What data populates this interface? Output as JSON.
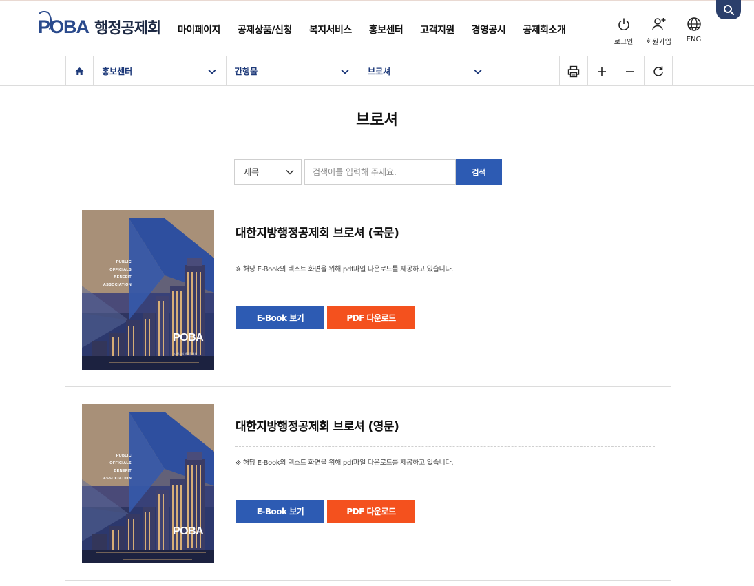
{
  "header": {
    "logo_mark": "POBA",
    "logo_name": "행정공제회",
    "nav": [
      "마이페이지",
      "공제상품/신청",
      "복지서비스",
      "홍보센터",
      "고객지원",
      "경영공시",
      "공제회소개"
    ],
    "util": {
      "login": "로그인",
      "join": "회원가입",
      "lang": "ENG"
    }
  },
  "location": {
    "depth1": "홍보센터",
    "depth2": "간행물",
    "depth3": "브로셔"
  },
  "page": {
    "title": "브로셔"
  },
  "search": {
    "field": "제목",
    "placeholder": "검색어를 입력해 주세요.",
    "button": "검색"
  },
  "cover": {
    "lines": [
      "PUBLIC",
      "OFFICIALS",
      "BENEFIT",
      "ASSOCIATION"
    ],
    "logo": "POBA",
    "logo_sub": "대한지방행정공제회"
  },
  "items": [
    {
      "title": "대한지방행정공제회 브로셔 (국문)",
      "note": "※ 해당 E-Book의 텍스트 화면을 위해 pdf파일 다운로드를 제공하고 있습니다.",
      "ebook_label": "E-Book 보기",
      "pdf_label": "PDF 다운로드"
    },
    {
      "title": "대한지방행정공제회 브로셔 (영문)",
      "note": "※ 해당 E-Book의 텍스트 화면을 위해 pdf파일 다운로드를 제공하고 있습니다.",
      "ebook_label": "E-Book 보기",
      "pdf_label": "PDF 다운로드"
    }
  ],
  "colors": {
    "primary": "#2d5bb3",
    "accent": "#f4511e",
    "navy": "#2b3f6b"
  },
  "icons": {
    "util": [
      "power-icon",
      "add-user-icon",
      "globe-icon"
    ],
    "search": "magnifier-icon",
    "location": [
      "home-icon",
      "chevron-down-icon"
    ],
    "tools": [
      "print-icon",
      "zoom-in-icon",
      "zoom-out-icon",
      "refresh-icon"
    ]
  }
}
